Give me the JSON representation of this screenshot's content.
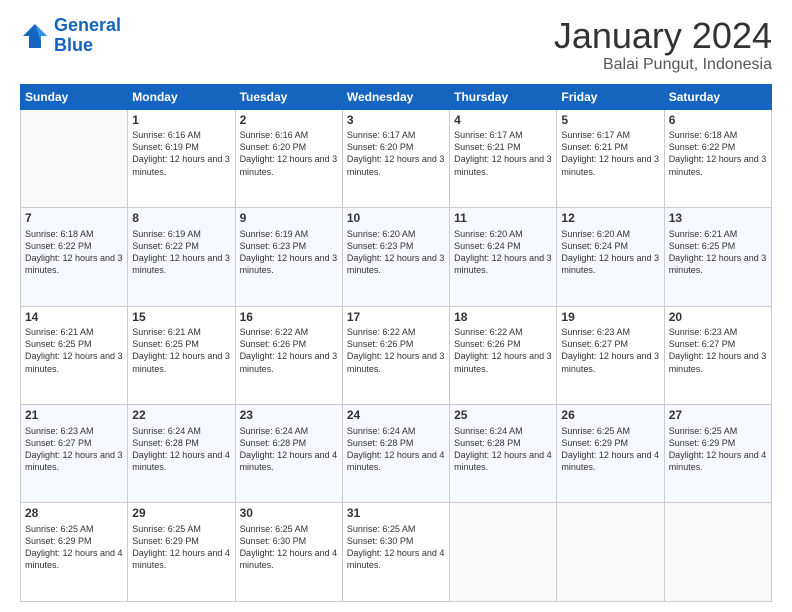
{
  "logo": {
    "line1": "General",
    "line2": "Blue"
  },
  "title": "January 2024",
  "subtitle": "Balai Pungut, Indonesia",
  "days": [
    "Sunday",
    "Monday",
    "Tuesday",
    "Wednesday",
    "Thursday",
    "Friday",
    "Saturday"
  ],
  "weeks": [
    [
      {
        "day": "",
        "sunrise": "",
        "sunset": "",
        "daylight": ""
      },
      {
        "day": "1",
        "sunrise": "6:16 AM",
        "sunset": "6:19 PM",
        "daylight": "12 hours and 3 minutes."
      },
      {
        "day": "2",
        "sunrise": "6:16 AM",
        "sunset": "6:20 PM",
        "daylight": "12 hours and 3 minutes."
      },
      {
        "day": "3",
        "sunrise": "6:17 AM",
        "sunset": "6:20 PM",
        "daylight": "12 hours and 3 minutes."
      },
      {
        "day": "4",
        "sunrise": "6:17 AM",
        "sunset": "6:21 PM",
        "daylight": "12 hours and 3 minutes."
      },
      {
        "day": "5",
        "sunrise": "6:17 AM",
        "sunset": "6:21 PM",
        "daylight": "12 hours and 3 minutes."
      },
      {
        "day": "6",
        "sunrise": "6:18 AM",
        "sunset": "6:22 PM",
        "daylight": "12 hours and 3 minutes."
      }
    ],
    [
      {
        "day": "7",
        "sunrise": "6:18 AM",
        "sunset": "6:22 PM",
        "daylight": "12 hours and 3 minutes."
      },
      {
        "day": "8",
        "sunrise": "6:19 AM",
        "sunset": "6:22 PM",
        "daylight": "12 hours and 3 minutes."
      },
      {
        "day": "9",
        "sunrise": "6:19 AM",
        "sunset": "6:23 PM",
        "daylight": "12 hours and 3 minutes."
      },
      {
        "day": "10",
        "sunrise": "6:20 AM",
        "sunset": "6:23 PM",
        "daylight": "12 hours and 3 minutes."
      },
      {
        "day": "11",
        "sunrise": "6:20 AM",
        "sunset": "6:24 PM",
        "daylight": "12 hours and 3 minutes."
      },
      {
        "day": "12",
        "sunrise": "6:20 AM",
        "sunset": "6:24 PM",
        "daylight": "12 hours and 3 minutes."
      },
      {
        "day": "13",
        "sunrise": "6:21 AM",
        "sunset": "6:25 PM",
        "daylight": "12 hours and 3 minutes."
      }
    ],
    [
      {
        "day": "14",
        "sunrise": "6:21 AM",
        "sunset": "6:25 PM",
        "daylight": "12 hours and 3 minutes."
      },
      {
        "day": "15",
        "sunrise": "6:21 AM",
        "sunset": "6:25 PM",
        "daylight": "12 hours and 3 minutes."
      },
      {
        "day": "16",
        "sunrise": "6:22 AM",
        "sunset": "6:26 PM",
        "daylight": "12 hours and 3 minutes."
      },
      {
        "day": "17",
        "sunrise": "6:22 AM",
        "sunset": "6:26 PM",
        "daylight": "12 hours and 3 minutes."
      },
      {
        "day": "18",
        "sunrise": "6:22 AM",
        "sunset": "6:26 PM",
        "daylight": "12 hours and 3 minutes."
      },
      {
        "day": "19",
        "sunrise": "6:23 AM",
        "sunset": "6:27 PM",
        "daylight": "12 hours and 3 minutes."
      },
      {
        "day": "20",
        "sunrise": "6:23 AM",
        "sunset": "6:27 PM",
        "daylight": "12 hours and 3 minutes."
      }
    ],
    [
      {
        "day": "21",
        "sunrise": "6:23 AM",
        "sunset": "6:27 PM",
        "daylight": "12 hours and 3 minutes."
      },
      {
        "day": "22",
        "sunrise": "6:24 AM",
        "sunset": "6:28 PM",
        "daylight": "12 hours and 4 minutes."
      },
      {
        "day": "23",
        "sunrise": "6:24 AM",
        "sunset": "6:28 PM",
        "daylight": "12 hours and 4 minutes."
      },
      {
        "day": "24",
        "sunrise": "6:24 AM",
        "sunset": "6:28 PM",
        "daylight": "12 hours and 4 minutes."
      },
      {
        "day": "25",
        "sunrise": "6:24 AM",
        "sunset": "6:28 PM",
        "daylight": "12 hours and 4 minutes."
      },
      {
        "day": "26",
        "sunrise": "6:25 AM",
        "sunset": "6:29 PM",
        "daylight": "12 hours and 4 minutes."
      },
      {
        "day": "27",
        "sunrise": "6:25 AM",
        "sunset": "6:29 PM",
        "daylight": "12 hours and 4 minutes."
      }
    ],
    [
      {
        "day": "28",
        "sunrise": "6:25 AM",
        "sunset": "6:29 PM",
        "daylight": "12 hours and 4 minutes."
      },
      {
        "day": "29",
        "sunrise": "6:25 AM",
        "sunset": "6:29 PM",
        "daylight": "12 hours and 4 minutes."
      },
      {
        "day": "30",
        "sunrise": "6:25 AM",
        "sunset": "6:30 PM",
        "daylight": "12 hours and 4 minutes."
      },
      {
        "day": "31",
        "sunrise": "6:25 AM",
        "sunset": "6:30 PM",
        "daylight": "12 hours and 4 minutes."
      },
      {
        "day": "",
        "sunrise": "",
        "sunset": "",
        "daylight": ""
      },
      {
        "day": "",
        "sunrise": "",
        "sunset": "",
        "daylight": ""
      },
      {
        "day": "",
        "sunrise": "",
        "sunset": "",
        "daylight": ""
      }
    ]
  ]
}
